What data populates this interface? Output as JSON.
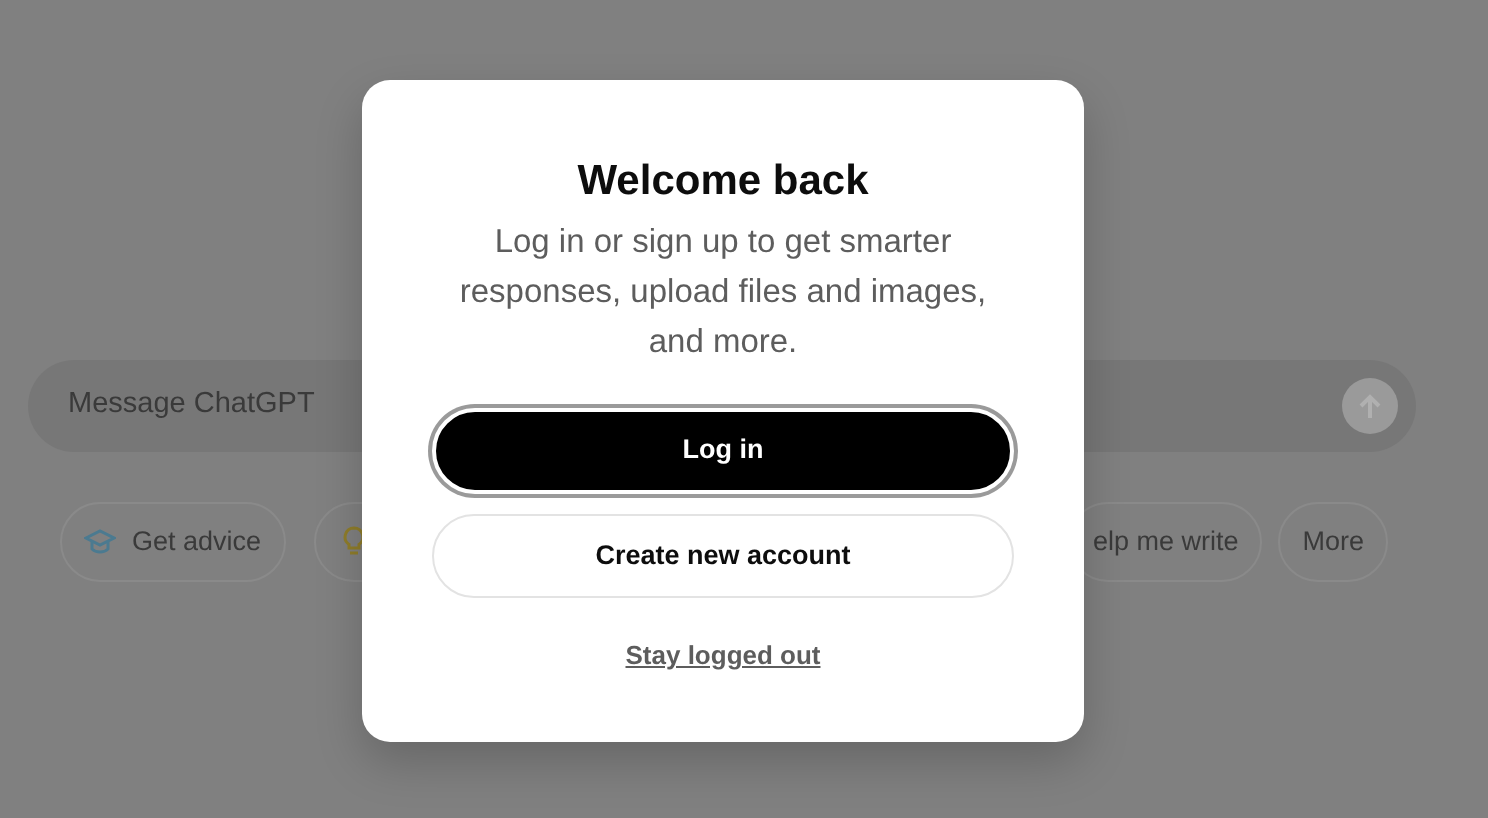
{
  "composer": {
    "placeholder": "Message ChatGPT"
  },
  "suggestions": [
    {
      "kind": "advice",
      "label": "Get advice"
    },
    {
      "kind": "bulb"
    },
    {
      "kind": "text",
      "label": "elp me write"
    },
    {
      "kind": "text",
      "label": "More"
    }
  ],
  "dialog": {
    "title": "Welcome back",
    "subtitle": "Log in or sign up to get smarter responses, upload files and images, and more.",
    "primary_button": "Log in",
    "secondary_button": "Create new account",
    "link": "Stay logged out"
  }
}
